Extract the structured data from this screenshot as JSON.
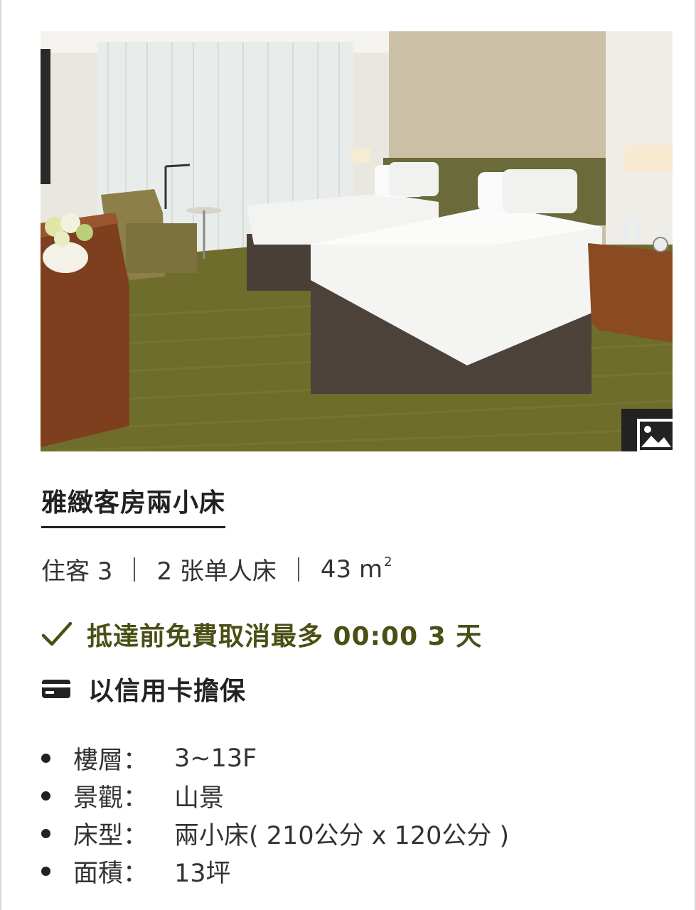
{
  "room": {
    "title": "雅緻客房兩小床",
    "specs": {
      "guests": "住客 3",
      "beds": "2 张单人床",
      "area_value": "43 m",
      "area_unit_sup": "2"
    },
    "cancellation": "抵達前免費取消最多 00:00 3 天",
    "guarantee": "以信用卡擔保",
    "details": [
      {
        "key": "樓層：",
        "value": "3~13F"
      },
      {
        "key": "景觀：",
        "value": "山景"
      },
      {
        "key": "床型：",
        "value": "兩小床( 210公分 x 120公分 )"
      },
      {
        "key": "面積：",
        "value": "13坪"
      }
    ]
  },
  "icons": {
    "gallery": "gallery-icon",
    "check": "check-icon",
    "card": "credit-card-icon"
  },
  "colors": {
    "accent_green": "#4a5015",
    "text": "#222222",
    "gallery_bg": "#222222"
  }
}
